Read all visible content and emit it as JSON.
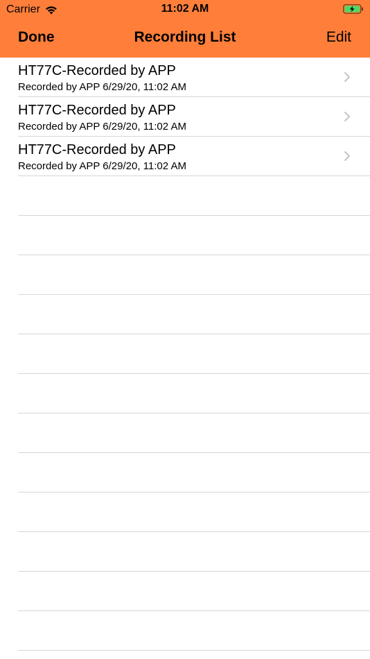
{
  "status_bar": {
    "carrier": "Carrier",
    "time": "11:02 AM",
    "wifi_icon": "wifi-icon",
    "battery_icon": "battery-charging-icon"
  },
  "nav": {
    "left_button": "Done",
    "title": "Recording List",
    "right_button": "Edit",
    "bar_color": "#ff7f3a"
  },
  "recordings": [
    {
      "title": "HT77C-Recorded by APP",
      "subtitle": "Recorded by APP  6/29/20, 11:02 AM"
    },
    {
      "title": "HT77C-Recorded by APP",
      "subtitle": "Recorded by APP  6/29/20, 11:02 AM"
    },
    {
      "title": "HT77C-Recorded by APP",
      "subtitle": "Recorded by APP  6/29/20, 11:02 AM"
    }
  ],
  "empty_rows": 12
}
